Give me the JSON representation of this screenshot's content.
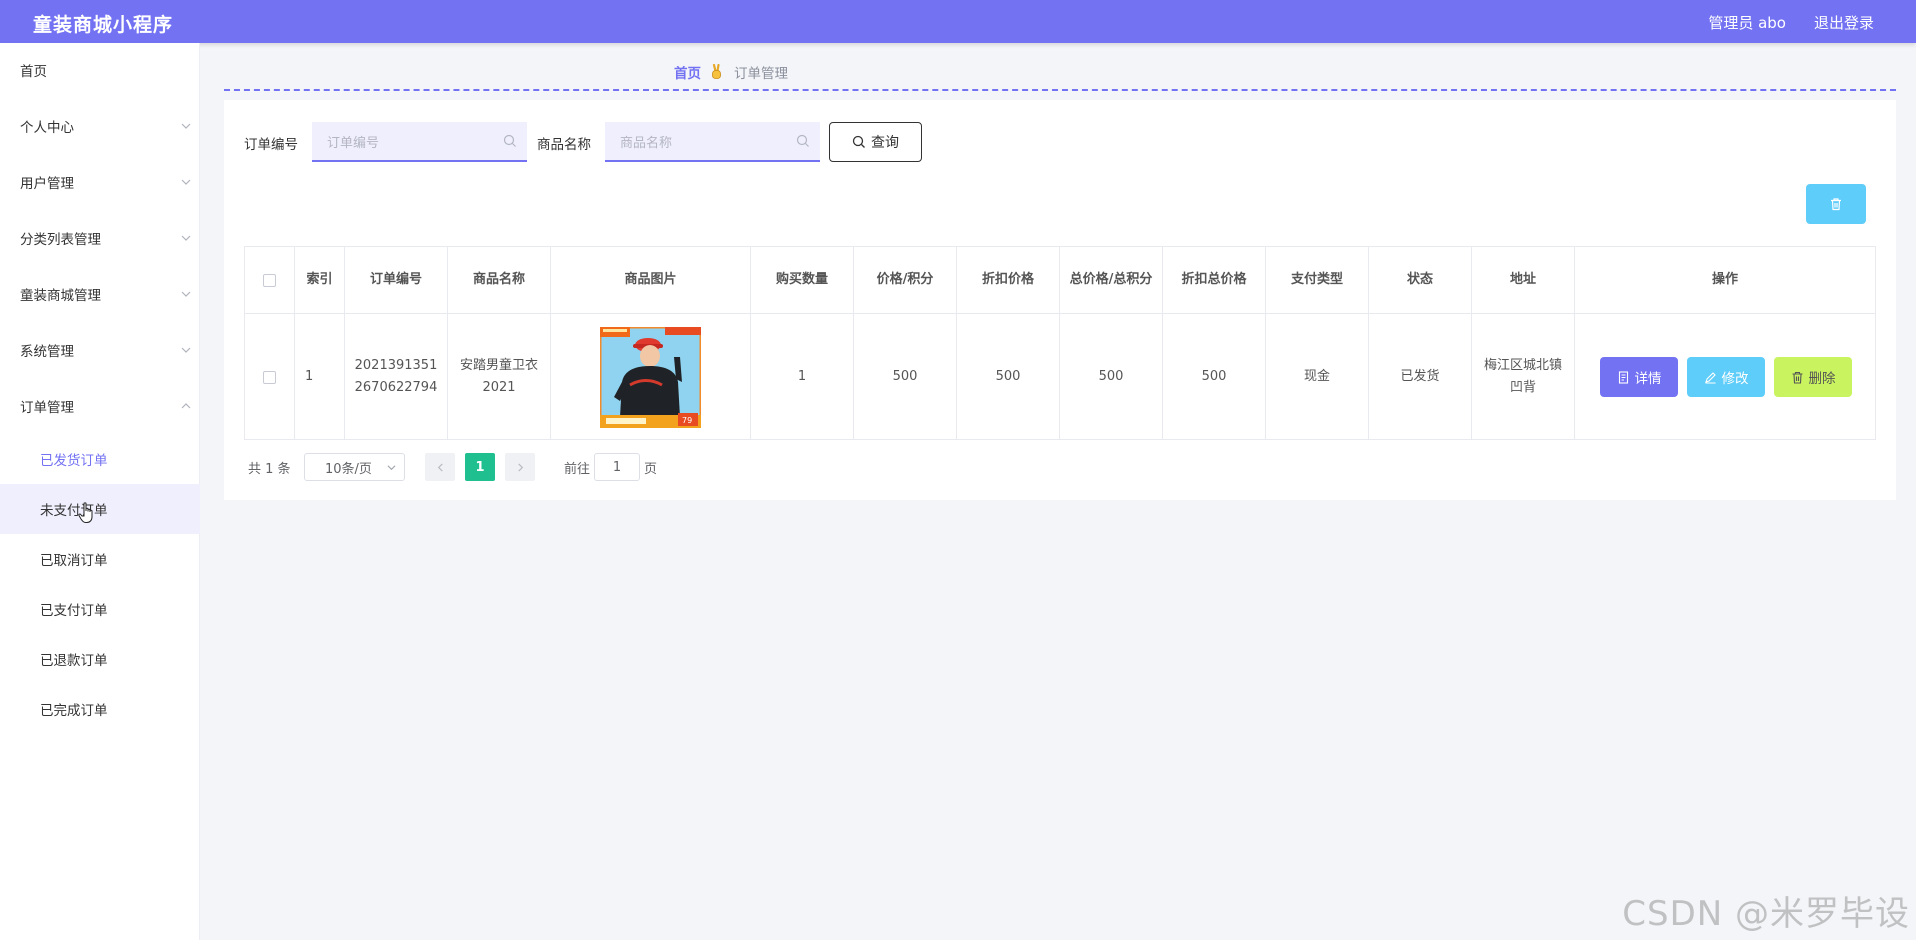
{
  "header": {
    "app_title": "童装商城小程序",
    "user_label": "管理员 abo",
    "logout_label": "退出登录"
  },
  "sidebar": {
    "items": [
      {
        "label": "首页",
        "has_children": false
      },
      {
        "label": "个人中心",
        "has_children": true
      },
      {
        "label": "用户管理",
        "has_children": true
      },
      {
        "label": "分类列表管理",
        "has_children": true
      },
      {
        "label": "童装商城管理",
        "has_children": true
      },
      {
        "label": "系统管理",
        "has_children": true
      },
      {
        "label": "订单管理",
        "has_children": true,
        "expanded": true
      }
    ],
    "order_sub_items": [
      {
        "label": "已发货订单",
        "state": "active"
      },
      {
        "label": "未支付订单",
        "state": "hover"
      },
      {
        "label": "已取消订单",
        "state": "normal"
      },
      {
        "label": "已支付订单",
        "state": "normal"
      },
      {
        "label": "已退款订单",
        "state": "normal"
      },
      {
        "label": "已完成订单",
        "state": "normal"
      }
    ]
  },
  "breadcrumb": {
    "home": "首页",
    "current": "订单管理"
  },
  "search": {
    "order_no_label": "订单编号",
    "order_no_placeholder": "订单编号",
    "product_name_label": "商品名称",
    "product_name_placeholder": "商品名称",
    "query_label": "查询"
  },
  "table": {
    "headers": [
      "索引",
      "订单编号",
      "商品名称",
      "商品图片",
      "购买数量",
      "价格/积分",
      "折扣价格",
      "总价格/总积分",
      "折扣总价格",
      "支付类型",
      "状态",
      "地址",
      "操作"
    ],
    "rows": [
      {
        "index": "1",
        "order_no": "20213913512670622794",
        "product_name": "安踏男童卫衣2021",
        "quantity": "1",
        "price": "500",
        "discount_price": "500",
        "total_price": "500",
        "discount_total": "500",
        "pay_type": "现金",
        "status": "已发货",
        "address": "梅江区城北镇凹背"
      }
    ],
    "actions": {
      "detail": "详情",
      "edit": "修改",
      "delete": "删除"
    }
  },
  "pagination": {
    "total": "共 1 条",
    "page_size": "10条/页",
    "current_page": "1",
    "goto_label": "前往",
    "goto_value": "1",
    "page_suffix": "页"
  },
  "watermark": "CSDN @米罗毕设",
  "colors": {
    "primary": "#7372f2",
    "info": "#5fcdf9",
    "danger_light": "#c9f45f",
    "pager_active": "#1fbf8f"
  }
}
